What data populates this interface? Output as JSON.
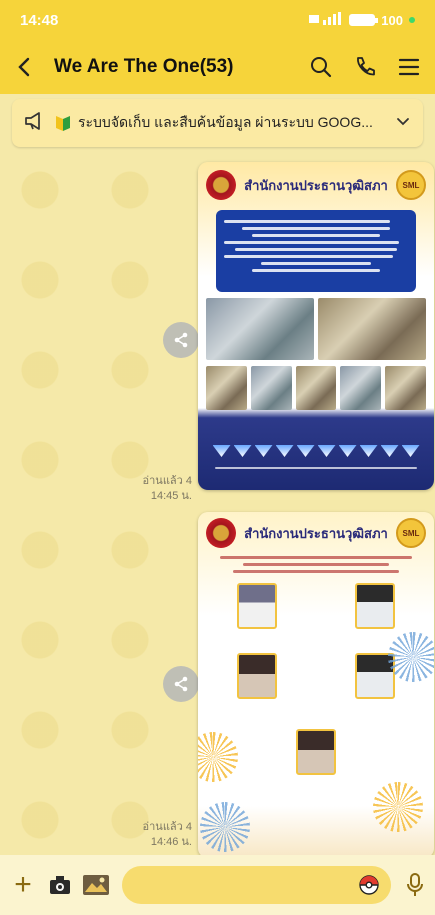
{
  "status_bar": {
    "time": "14:48",
    "battery": "100"
  },
  "header": {
    "title": "We Are The One(53)"
  },
  "announcement": {
    "text": "ระบบจัดเก็บ และสืบค้นข้อมูล ผ่านระบบ GOOG..."
  },
  "messages": [
    {
      "poster_title": "สำนักงานประธานวุฒิสภา",
      "badge": "SML",
      "read_label": "อ่านแล้ว 4",
      "time": "14:45 น."
    },
    {
      "poster_title": "สำนักงานประธานวุฒิสภา",
      "badge": "SML",
      "read_label": "อ่านแล้ว 4",
      "time": "14:46 น."
    }
  ],
  "colors": {
    "header_bg": "#f6d43a",
    "chat_bg": "#f5e9a9",
    "poster_blue": "#1a3ea3"
  }
}
